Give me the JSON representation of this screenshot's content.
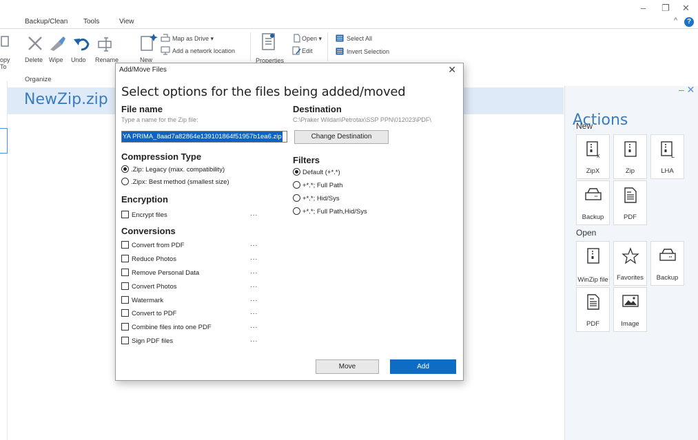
{
  "window": {
    "minimize": "–",
    "restore": "❐",
    "close": "✕",
    "collapse": "^",
    "help": "?"
  },
  "menu": {
    "tabs": [
      "Backup/Clean",
      "Tools",
      "View"
    ]
  },
  "ribbon": {
    "partial_left": [
      "opy",
      "To"
    ],
    "buttons": [
      "Delete",
      "Wipe",
      "Undo",
      "Rename",
      "New",
      "Properties"
    ],
    "map_as_drive": "Map as Drive ▾",
    "add_network": "Add a network location",
    "open": "Open ▾",
    "edit": "Edit",
    "select_all": "Select All",
    "invert_selection": "Invert Selection",
    "group_organize": "Organize"
  },
  "left_pane": {
    "title": "NewZip.zip"
  },
  "actions": {
    "title": "Actions",
    "pane_controls": "– ✕",
    "new_label": "New",
    "new_items": [
      "ZipX",
      "Zip",
      "LHA",
      "Backup",
      "PDF"
    ],
    "open_label": "Open",
    "open_items": [
      "WinZip file",
      "Favorites",
      "Backup",
      "PDF",
      "Image"
    ]
  },
  "dialog": {
    "title": "Add/Move Files",
    "close": "✕",
    "heading": "Select options for the files being added/moved",
    "file_name": {
      "label": "File name",
      "hint": "Type a name for the Zip file:",
      "value": "YA PRIMA_8aad7a82864e139101864f51957b1ea6.zip"
    },
    "destination": {
      "label": "Destination",
      "path": "C:\\Praker Wildan\\Petrotax\\SSP PPN\\012023\\PDF\\",
      "change_button": "Change Destination"
    },
    "compression": {
      "label": "Compression Type",
      "options": [
        ".Zip: Legacy (max. compatibility)",
        ".Zipx: Best method (smallest size)"
      ],
      "selected": 0
    },
    "filters": {
      "label": "Filters",
      "options": [
        "Default (+*.*)",
        "+*.*; Full Path",
        "+*.*; Hid/Sys",
        "+*.*; Full Path,Hid/Sys"
      ],
      "selected": 0
    },
    "encryption": {
      "label": "Encryption",
      "option": "Encrypt files"
    },
    "conversions": {
      "label": "Conversions",
      "options": [
        "Convert from PDF",
        "Reduce Photos",
        "Remove Personal Data",
        "Convert Photos",
        "Watermark",
        "Convert to PDF",
        "Combine files into one PDF",
        "Sign PDF files"
      ]
    },
    "more": "...",
    "move_button": "Move",
    "add_button": "Add"
  },
  "colors": {
    "accent": "#0f6cc4",
    "title_blue": "#3a7cc0",
    "header_bg": "#dfeaf8"
  }
}
